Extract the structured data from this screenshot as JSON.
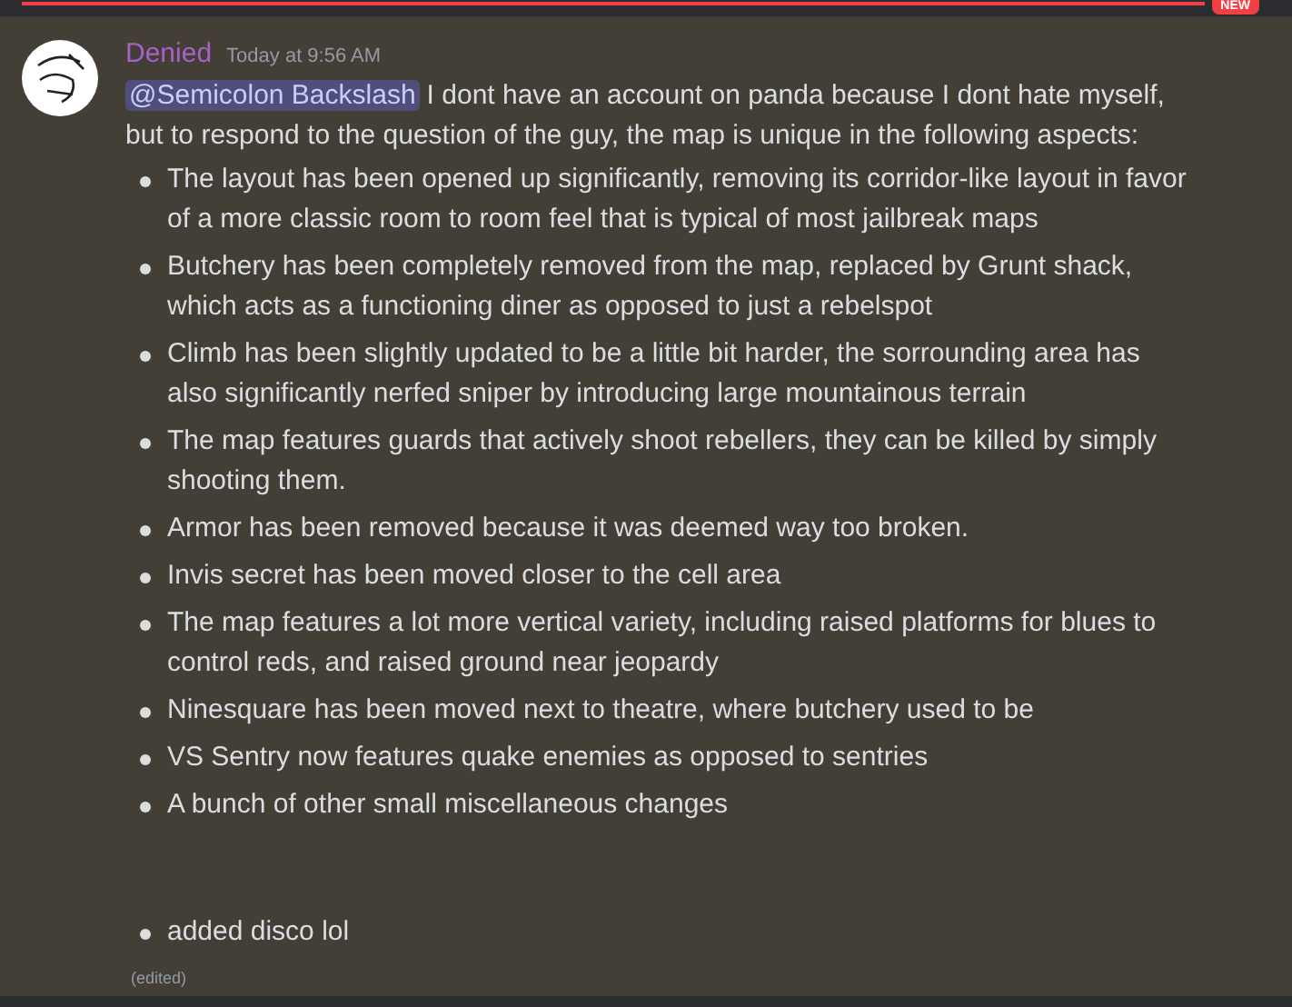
{
  "new_badge": "NEW",
  "message": {
    "author": "Denied",
    "timestamp": "Today at 9:56 AM",
    "mention": "@Semicolon Backslash",
    "text": "I dont have an account on panda because I dont hate myself, but to respond to the question of the guy, the map is unique in the following aspects:",
    "bullets": [
      "The layout has been opened up significantly, removing its corridor-like layout in favor of a more classic room to room feel that is typical of most jailbreak maps",
      "Butchery has been completely removed from the map, replaced by Grunt shack, which acts as a functioning diner as opposed to just a rebelspot",
      "Climb has been slightly updated to be a little bit harder, the sorrounding area has also significantly nerfed sniper by introducing large mountainous terrain",
      "The map features guards that actively shoot rebellers, they can be killed by simply shooting them.",
      "Armor has been removed because it was deemed way too broken.",
      "Invis secret has been moved closer to the cell area",
      "The map features a lot more vertical variety, including raised platforms for blues to control reds, and raised ground near jeopardy",
      "Ninesquare has been moved next to theatre, where butchery used to be",
      "VS Sentry now features quake enemies as opposed to sentries",
      "A bunch of other small miscellaneous changes"
    ],
    "extra_bullets": [
      "added disco lol"
    ],
    "edited": "(edited)"
  }
}
